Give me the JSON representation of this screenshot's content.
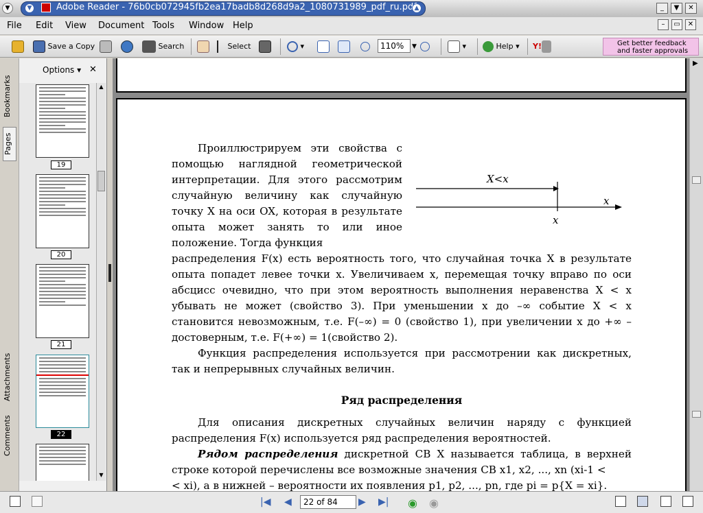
{
  "window": {
    "title": "Adobe Reader - 76b0cb072945fb2ea17badb8d268d9a2_1080731989_pdf_ru.pdf",
    "controls": [
      "_",
      "▼",
      "✕"
    ]
  },
  "menu": {
    "items": [
      {
        "label": "File"
      },
      {
        "label": "Edit"
      },
      {
        "label": "View"
      },
      {
        "label": "Document"
      },
      {
        "label": "Tools"
      },
      {
        "label": "Window"
      },
      {
        "label": "Help"
      }
    ],
    "mdi_controls": [
      "–",
      "▭",
      "✕"
    ]
  },
  "toolbar": {
    "save_copy": "Save a Copy",
    "search": "Search",
    "select": "Select",
    "zoom": "110%",
    "help": "Help",
    "feedback_line1": "Get better feedback",
    "feedback_line2": "and faster approvals",
    "y_logo": "Y!"
  },
  "sidebar": {
    "tabs": [
      "Bookmarks",
      "Pages",
      "Attachments",
      "Comments"
    ],
    "options_label": "Options ▾",
    "close": "✕",
    "pages": [
      {
        "label": "19",
        "selected": false
      },
      {
        "label": "20",
        "selected": false
      },
      {
        "label": "21",
        "selected": false
      },
      {
        "label": "22",
        "selected": true
      },
      {
        "label": "",
        "selected": false
      }
    ]
  },
  "document": {
    "para1": "Проиллюстрируем эти свойства с помощью наглядной геометрической интерпретации. Для этого рассмотрим случайную величину как случайную точку X на оси OX, которая в результате опыта может занять то или иное положение. Тогда функция",
    "para1_cont": "распределения F(x) есть вероятность того, что случайная точка X в результате опыта попадет левее точки x. Увеличиваем x, перемещая точку вправо по оси абсцисс очевидно, что при этом вероятность выполнения неравенства X < x убывать не может (свойство 3). При уменьшении x до –∞ событие X < x становится невозможным, т.е. F(–∞) = 0 (свойство 1), при увеличении x до +∞ – достоверным, т.е. F(+∞) = 1(свойство 2).",
    "para2": "Функция распределения используется при рассмотрении как дискретных, так и непрерывных случайных величин.",
    "heading": "Ряд распределения",
    "para3": "Для описания дискретных случайных величин наряду с функцией распределения F(x) используется ряд распределения вероятностей.",
    "para4_bold": "Рядом распределения",
    "para4": " дискретной СВ X называется таблица, в верхней строке которой перечислены все возможные значения СВ x1, x2, ..., xn (xi-1 <",
    "para4_cut": "< xi), а в нижней – вероятности их появления p1, p2, ..., pn, где pi = p{X = xi}.",
    "figure": {
      "upper_label": "X<x",
      "axis_label": "x",
      "tick_label": "x"
    }
  },
  "status": {
    "page_field": "22 of 84"
  }
}
